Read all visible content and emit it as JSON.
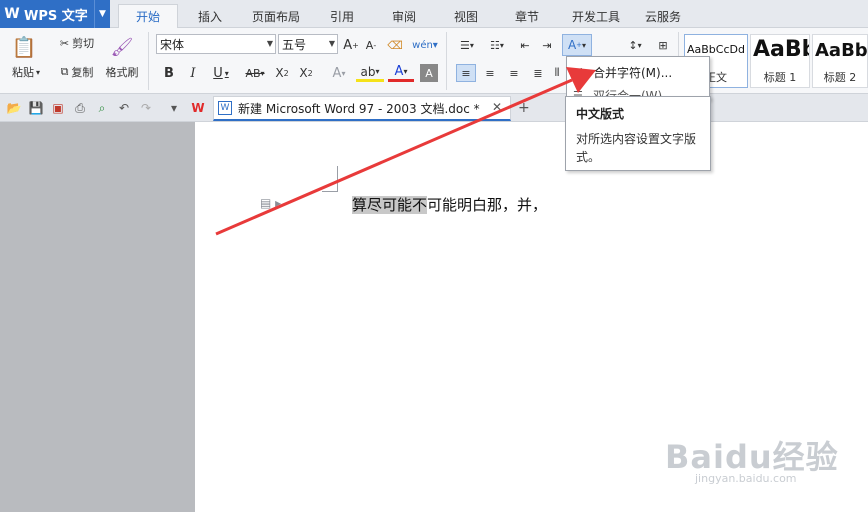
{
  "app": {
    "title": "WPS 文字",
    "logo_glyph": "W"
  },
  "menu": {
    "tabs": [
      {
        "label": "开始",
        "active": true
      },
      {
        "label": "插入"
      },
      {
        "label": "页面布局"
      },
      {
        "label": "引用"
      },
      {
        "label": "审阅"
      },
      {
        "label": "视图"
      },
      {
        "label": "章节"
      },
      {
        "label": "开发工具"
      },
      {
        "label": "云服务"
      }
    ]
  },
  "ribbon": {
    "paste_label": "粘贴",
    "cut_label": "剪切",
    "copy_label": "复制",
    "format_painter_label": "格式刷",
    "font_name": "宋体",
    "font_size": "五号",
    "styles": [
      {
        "sample": "AaBbCcDd",
        "name": "正文"
      },
      {
        "sample": "AaBb",
        "name": "标题 1"
      },
      {
        "sample": "AaBb",
        "name": "标题 2"
      }
    ]
  },
  "document_tab": {
    "title": "新建 Microsoft Word 97 - 2003 文档.doc *"
  },
  "document": {
    "selected_text": "算尽可能不",
    "rest_text": "可能明白那，并，"
  },
  "dropdown": {
    "items": [
      {
        "label": "合并字符(M)..."
      },
      {
        "label": "双行合一(W)..."
      }
    ]
  },
  "tooltip": {
    "title": "中文版式",
    "body": "对所选内容设置文字版式。"
  },
  "watermark": {
    "brand": "Baidu经验",
    "url": "jingyan.baidu.com"
  },
  "colors": {
    "accent": "#2f6fc6",
    "arrow": "#e83a3a",
    "page_bg": "#ffffff",
    "workspace_bg": "#b9bbbf"
  }
}
